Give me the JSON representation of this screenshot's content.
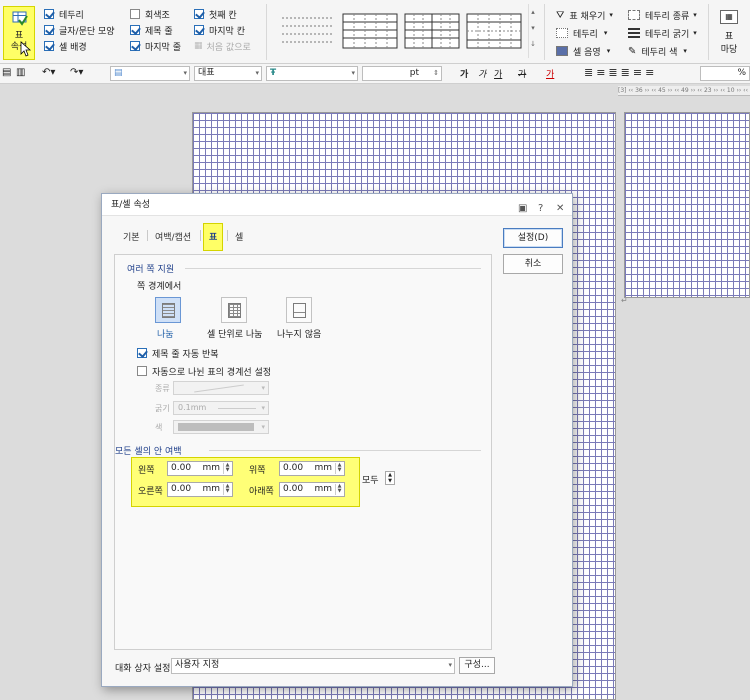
{
  "ribbon": {
    "table_props": {
      "line1": "표",
      "line2": "속성"
    },
    "checks_col1": [
      {
        "label": "테두리",
        "checked": true
      },
      {
        "label": "글자/문단 모양",
        "checked": true
      },
      {
        "label": "셀 배경",
        "checked": true
      }
    ],
    "checks_col2": [
      {
        "label": "회색조",
        "checked": false
      },
      {
        "label": "제목 줄",
        "checked": true
      },
      {
        "label": "마지막 줄",
        "checked": true
      }
    ],
    "checks_col3": [
      {
        "label": "첫째 칸",
        "checked": true
      },
      {
        "label": "마지막 칸",
        "checked": true
      },
      {
        "label": "처음 값으로",
        "checked": false,
        "disabled": true
      }
    ],
    "fill_menu": [
      {
        "label": "표 채우기",
        "icon": "fill-bucket-icon"
      },
      {
        "label": "테두리",
        "icon": "border-icon"
      },
      {
        "label": "셀 음영",
        "icon": "cell-shade-icon"
      }
    ],
    "border_menu": [
      {
        "label": "테두리 종류",
        "icon": "border-type-icon"
      },
      {
        "label": "테두리 굵기",
        "icon": "border-weight-icon"
      },
      {
        "label": "테두리 색",
        "icon": "border-color-icon"
      }
    ],
    "right_big": {
      "line1": "표",
      "line2": "마당"
    }
  },
  "toolbar2": {
    "style_value": "대표",
    "font_value": "",
    "size_unit": "pt",
    "bold": "가",
    "italic": "가",
    "underline": "가",
    "strike": "가",
    "font_color": "가",
    "zoom_suffix": "%"
  },
  "ruler_text": "[3] ‹‹ 36 ›› ‹‹ 45 ›› ‹‹ 49 ›› ‹‹ 23 ›› ‹‹ 10 ›› ‹‹",
  "dialog": {
    "title": "표/셀 속성",
    "tabs": [
      {
        "label": "기본"
      },
      {
        "label": "여백/캡션"
      },
      {
        "label": "표",
        "active": true
      },
      {
        "label": "셀"
      }
    ],
    "ok_button": "설정(D)",
    "cancel_button": "취소",
    "multi_page": {
      "title": "여러 쪽 지원",
      "boundary_label": "쪽 경계에서",
      "options": [
        {
          "label": "나눔",
          "selected": true
        },
        {
          "label": "셀 단위로 나눔",
          "selected": false
        },
        {
          "label": "나누지 않음",
          "selected": false
        }
      ],
      "repeat_header": {
        "label": "제목 줄 자동 반복",
        "checked": true
      },
      "auto_border": {
        "label": "자동으로 나뉜 표의 경계선 설정",
        "checked": false
      },
      "type_label": "종류",
      "weight_label": "굵기",
      "weight_value": "0.1mm",
      "color_label": "색"
    },
    "cell_margins": {
      "title": "모든 셀의 안 여백",
      "left_label": "왼쪽",
      "left_value": "0.00",
      "top_label": "위쪽",
      "top_value": "0.00",
      "right_label": "오른쪽",
      "right_value": "0.00",
      "bottom_label": "아래쪽",
      "bottom_value": "0.00",
      "unit": "mm",
      "all_label": "모두"
    },
    "footer": {
      "settings_label": "대화 상자 설정",
      "settings_value": "사용자 지정",
      "config_button": "구성..."
    }
  }
}
